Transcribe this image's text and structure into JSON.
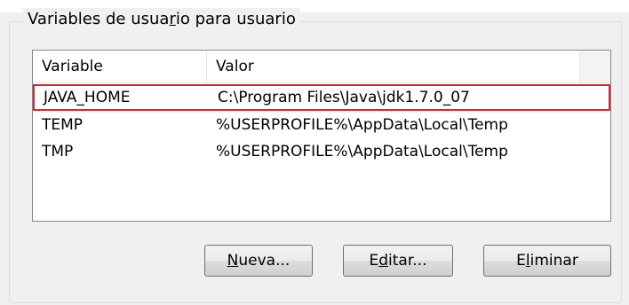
{
  "group": {
    "title_pre": "Variables de usua",
    "title_mnemonic": "r",
    "title_post": "io para usuario"
  },
  "list": {
    "columns": [
      "Variable",
      "Valor"
    ],
    "rows": [
      {
        "variable": "JAVA_HOME",
        "valor": "C:\\Program Files\\Java\\jdk1.7.0_07",
        "selected": true
      },
      {
        "variable": "TEMP",
        "valor": "%USERPROFILE%\\AppData\\Local\\Temp",
        "selected": false
      },
      {
        "variable": "TMP",
        "valor": "%USERPROFILE%\\AppData\\Local\\Temp",
        "selected": false
      }
    ]
  },
  "buttons": {
    "new": {
      "mnemonic": "N",
      "rest": "ueva..."
    },
    "edit": {
      "pre": "E",
      "mnemonic": "d",
      "rest": "itar..."
    },
    "delete": {
      "pre": "E",
      "mnemonic": "l",
      "rest": "iminar"
    }
  },
  "colors": {
    "selection_outline": "#d9262e"
  }
}
